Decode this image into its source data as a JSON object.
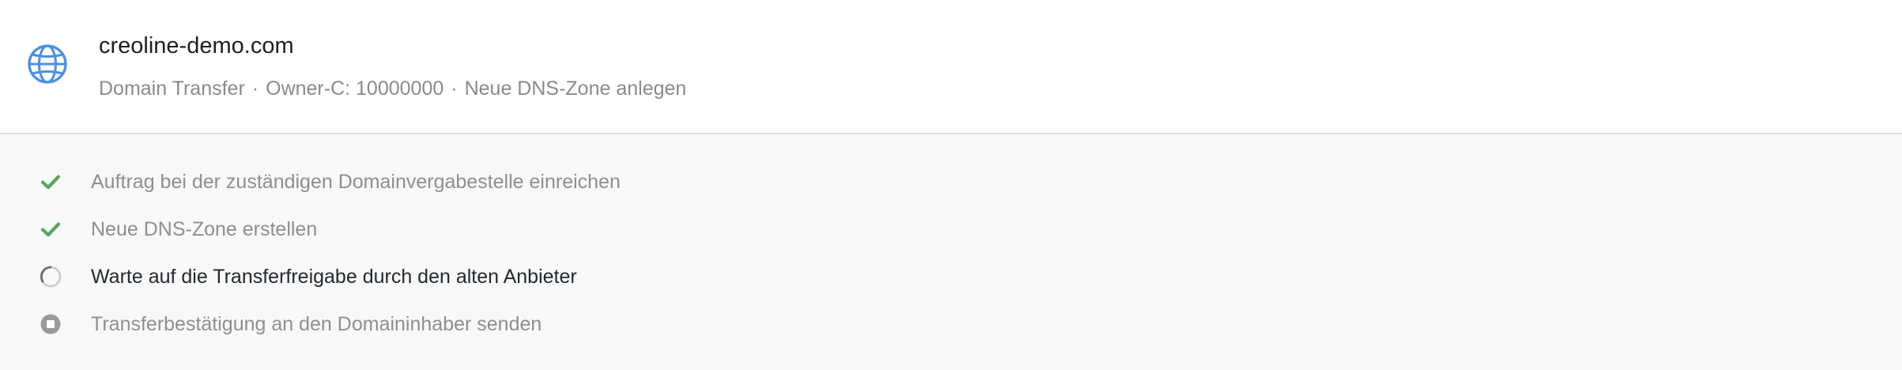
{
  "header": {
    "domain": "creoline-demo.com",
    "meta": {
      "type": "Domain Transfer",
      "owner": "Owner-C: 10000000",
      "zone": "Neue DNS-Zone anlegen",
      "separator": "·"
    },
    "icon": "globe-icon"
  },
  "steps": [
    {
      "label": "Auftrag bei der zuständigen Domainvergabestelle einreichen",
      "status": "done",
      "icon": "check-icon"
    },
    {
      "label": "Neue DNS-Zone erstellen",
      "status": "done",
      "icon": "check-icon"
    },
    {
      "label": "Warte auf die Transferfreigabe durch den alten Anbieter",
      "status": "in-progress",
      "icon": "spinner-icon"
    },
    {
      "label": "Transferbestätigung an den Domaininhaber senden",
      "status": "pending",
      "icon": "pending-icon"
    }
  ],
  "colors": {
    "accent": "#4a90e2",
    "success": "#58a55c",
    "muted": "#8f8f8f",
    "pending": "#9a9a9a"
  }
}
